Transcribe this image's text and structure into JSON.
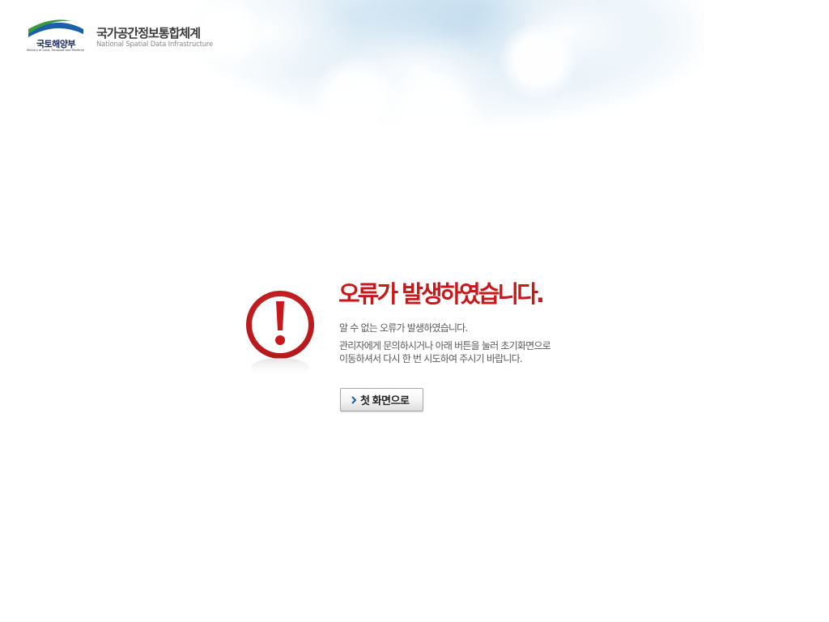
{
  "header": {
    "ministry_name": "국토해양부",
    "ministry_english": "Ministry of Land, Transport and Maritime Affairs",
    "system_title": "국가공간정보통합체계",
    "system_subtitle": "National Spatial Data Infrastructure"
  },
  "error": {
    "title": "오류가 발생하였습니다.",
    "line1": "알 수 없는 오류가 발생하였습니다.",
    "line2": "관리자에게 문의하시거나 아래 버튼을 눌러 초기화면으로",
    "line3": "이동하셔서 다시 한 번 시도하여 주시기 바랍니다.",
    "home_button_label": "첫 화면으로"
  },
  "icons": {
    "error": "exclamation-circle-icon",
    "button_arrow": "chevron-right-icon"
  },
  "colors": {
    "error_red": "#c8181b",
    "logo_green": "#3a9a3c",
    "logo_blue": "#1a5fa8",
    "logo_navy": "#1d2b5e"
  }
}
